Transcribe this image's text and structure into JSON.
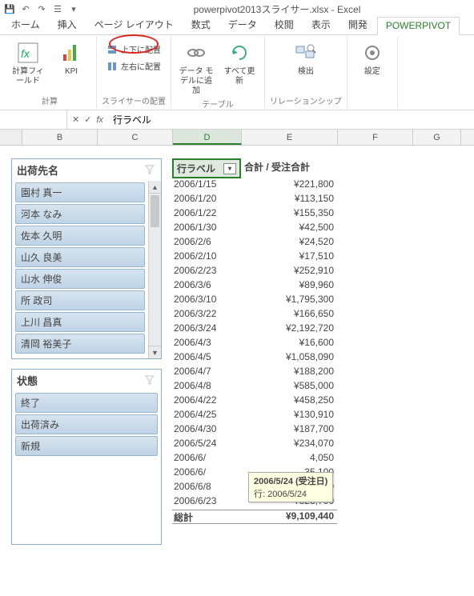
{
  "title": "powerpivot2013スライサー.xlsx - Excel",
  "tabs": [
    "ホーム",
    "挿入",
    "ページ レイアウト",
    "数式",
    "データ",
    "校閲",
    "表示",
    "開発",
    "POWERPIVOT"
  ],
  "active_tab": "POWERPIVOT",
  "ribbon": {
    "calc_field": "計算フィールド",
    "kpi": "KPI",
    "calc_group": "計算",
    "slicer_vert": "上下に配置",
    "slicer_horz": "左右に配置",
    "slicer_group": "スライサーの配置",
    "model_add": "データ モデルに追加",
    "refresh": "すべて更新",
    "table_group": "テーブル",
    "detect": "検出",
    "relation_group": "リレーションシップ",
    "settings": "設定"
  },
  "formula_bar": {
    "namebox": "",
    "value": "行ラベル"
  },
  "columns": [
    "B",
    "C",
    "D",
    "E",
    "F",
    "G"
  ],
  "active_col": "D",
  "slicer1": {
    "title": "出荷先名",
    "items": [
      "園村 真一",
      "河本 なみ",
      "佐本 久明",
      "山久 良美",
      "山水 伸俊",
      "所 政司",
      "上川 昌真",
      "清岡 裕美子"
    ]
  },
  "slicer2": {
    "title": "状態",
    "items": [
      "終了",
      "出荷済み",
      "新規"
    ]
  },
  "pivot": {
    "row_label_header": "行ラベル",
    "value_header": "合計 / 受注合計",
    "rows": [
      {
        "k": "2006/1/15",
        "v": "¥221,800"
      },
      {
        "k": "2006/1/20",
        "v": "¥113,150"
      },
      {
        "k": "2006/1/22",
        "v": "¥155,350"
      },
      {
        "k": "2006/1/30",
        "v": "¥42,500"
      },
      {
        "k": "2006/2/6",
        "v": "¥24,520"
      },
      {
        "k": "2006/2/10",
        "v": "¥17,510"
      },
      {
        "k": "2006/2/23",
        "v": "¥252,910"
      },
      {
        "k": "2006/3/6",
        "v": "¥89,960"
      },
      {
        "k": "2006/3/10",
        "v": "¥1,795,300"
      },
      {
        "k": "2006/3/22",
        "v": "¥166,650"
      },
      {
        "k": "2006/3/24",
        "v": "¥2,192,720"
      },
      {
        "k": "2006/4/3",
        "v": "¥16,600"
      },
      {
        "k": "2006/4/5",
        "v": "¥1,058,090"
      },
      {
        "k": "2006/4/7",
        "v": "¥188,200"
      },
      {
        "k": "2006/4/8",
        "v": "¥585,000"
      },
      {
        "k": "2006/4/22",
        "v": "¥458,250"
      },
      {
        "k": "2006/4/25",
        "v": "¥130,910"
      },
      {
        "k": "2006/4/30",
        "v": "¥187,700"
      },
      {
        "k": "2006/5/24",
        "v": "¥234,070"
      },
      {
        "k": "2006/6/",
        "v": "4,050"
      },
      {
        "k": "2006/6/",
        "v": "35,100"
      },
      {
        "k": "2006/6/8",
        "v": "¥105,400"
      },
      {
        "k": "2006/6/23",
        "v": "¥323,700"
      }
    ],
    "total_label": "総計",
    "total_value": "¥9,109,440"
  },
  "tooltip": {
    "line1": "2006/5/24 (受注日)",
    "line2": "行: 2006/5/24"
  }
}
